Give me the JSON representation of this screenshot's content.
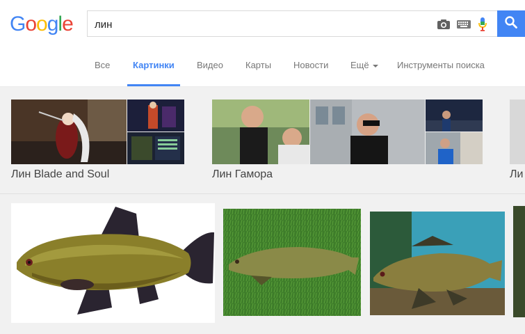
{
  "logo": {
    "letters": [
      "G",
      "o",
      "o",
      "g",
      "l",
      "e"
    ],
    "colors": [
      "#4285f4",
      "#ea4335",
      "#fbbc05",
      "#4285f4",
      "#34a853",
      "#ea4335"
    ]
  },
  "search": {
    "value": "лин",
    "camera_icon": "camera-icon",
    "keyboard_icon": "keyboard-icon",
    "mic_icon": "microphone-icon",
    "button_icon": "search-icon"
  },
  "tabs": [
    {
      "label": "Все",
      "active": false
    },
    {
      "label": "Картинки",
      "active": true
    },
    {
      "label": "Видео",
      "active": false
    },
    {
      "label": "Карты",
      "active": false
    },
    {
      "label": "Новости",
      "active": false
    },
    {
      "label": "Ещё",
      "active": false,
      "icon": "caret-down-icon"
    },
    {
      "label": "Инструменты поиска",
      "active": false
    }
  ],
  "clusters": [
    {
      "label": "Лин Blade and Soul"
    },
    {
      "label": "Лин Гамора"
    },
    {
      "label": "Ли"
    }
  ],
  "results": [
    "fish-image-1",
    "fish-image-2",
    "fish-image-3",
    "fish-image-4"
  ],
  "colors": {
    "accent": "#4285f4"
  }
}
